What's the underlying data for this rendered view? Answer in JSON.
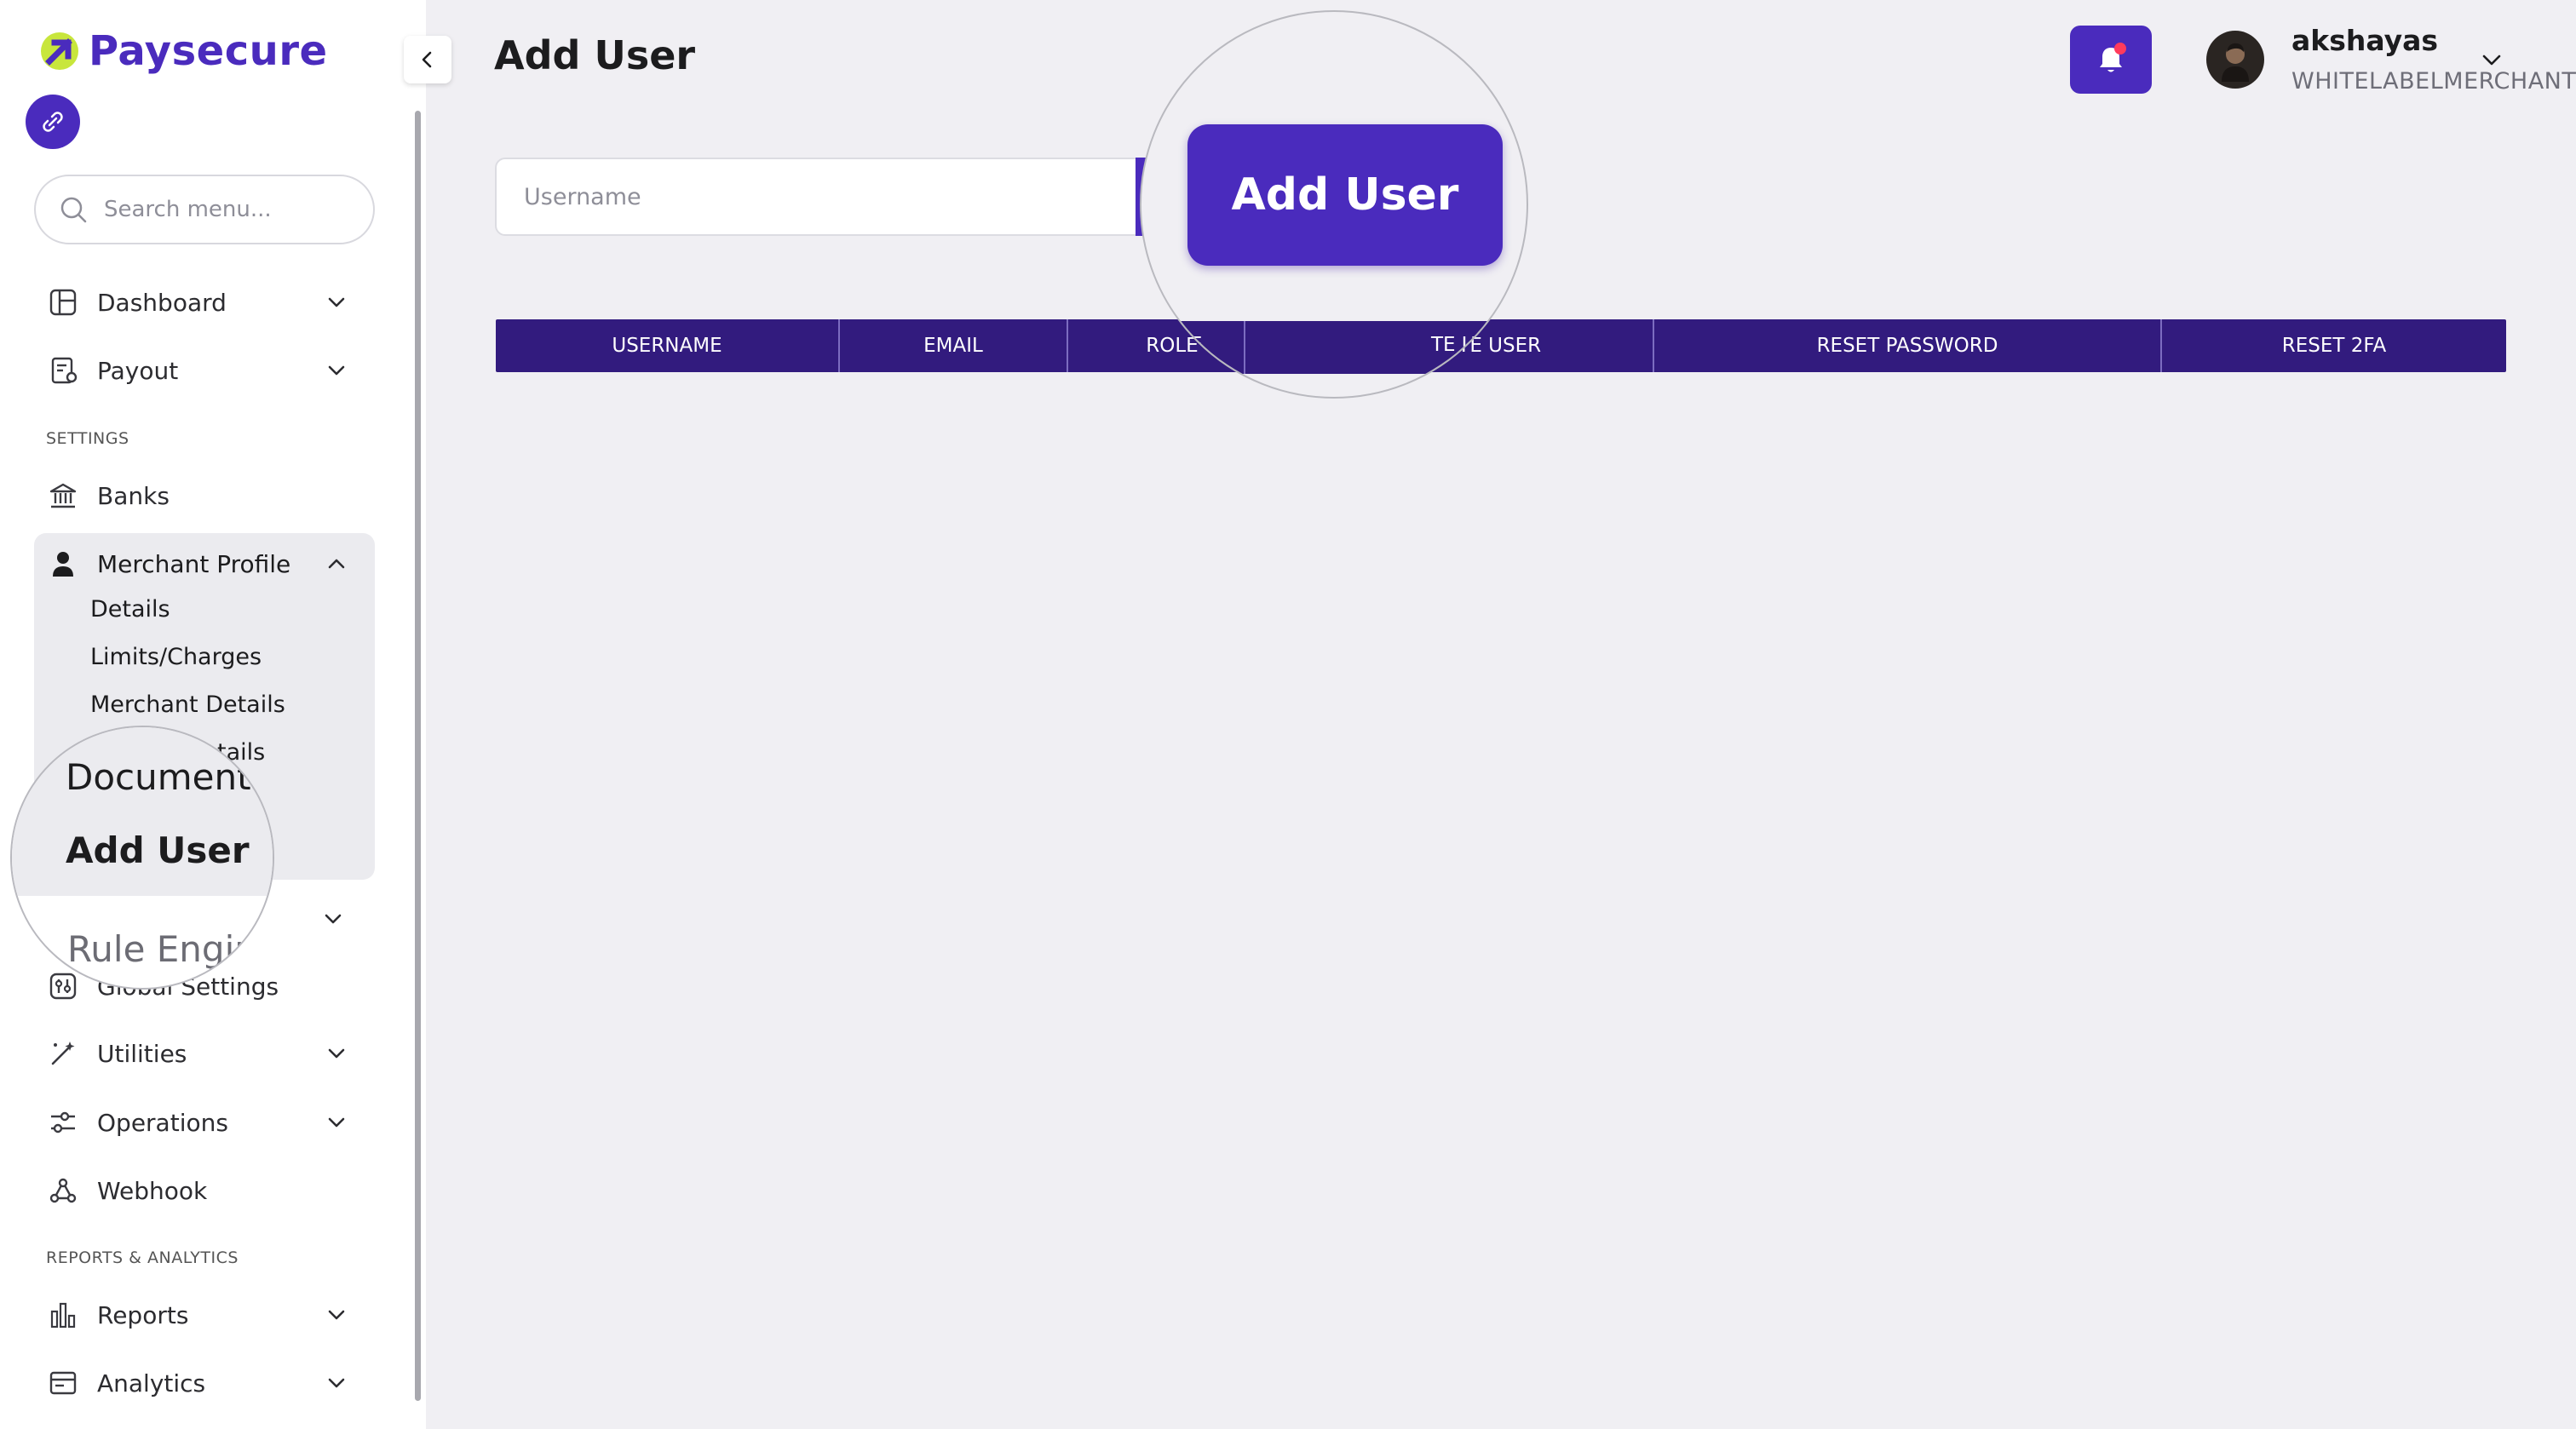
{
  "brand": {
    "name": "Paysecure",
    "accent": "#4a2bbd",
    "header_purple": "#321b7e"
  },
  "search": {
    "placeholder": "Search menu..."
  },
  "sidebar": {
    "items": [
      {
        "label": "Dashboard",
        "icon": "dashboard-icon",
        "expandable": true
      },
      {
        "label": "Payout",
        "icon": "payout-icon",
        "expandable": true
      }
    ],
    "settings_label": "SETTINGS",
    "settings_items": [
      {
        "label": "Banks",
        "icon": "bank-icon"
      },
      {
        "label": "Merchant Profile",
        "icon": "user-icon",
        "expanded": true,
        "children": [
          "Details",
          "Limits/Charges",
          "Merchant Details",
          "Documents",
          "Add User"
        ]
      },
      {
        "label": "Global Settings",
        "icon": "sliders-icon"
      },
      {
        "label": "Utilities",
        "icon": "wand-icon",
        "expandable": true
      },
      {
        "label": "Operations",
        "icon": "operations-icon",
        "expandable": true
      },
      {
        "label": "Webhook",
        "icon": "webhook-icon"
      }
    ],
    "reports_label": "REPORTS & ANALYTICS",
    "reports_items": [
      {
        "label": "Reports",
        "icon": "bar-chart-icon",
        "expandable": true
      },
      {
        "label": "Analytics",
        "icon": "analytics-icon",
        "expandable": true
      }
    ],
    "zoom": {
      "documents": "Documents",
      "add_user": "Add User",
      "rule_engine": "Rule Engin",
      "details_frag": "tails"
    }
  },
  "header": {
    "title": "Add User",
    "user_name": "akshayas",
    "user_role": "WHITELABELMERCHANT"
  },
  "form": {
    "username_placeholder": "Username",
    "add_button": "Add User"
  },
  "table": {
    "columns": [
      "USERNAME",
      "EMAIL",
      "ROLE",
      "ACTIVATE USER",
      "RESET PASSWORD",
      "RESET 2FA"
    ],
    "zoom_role": "ROLE",
    "zoom_user": "TE USER"
  }
}
